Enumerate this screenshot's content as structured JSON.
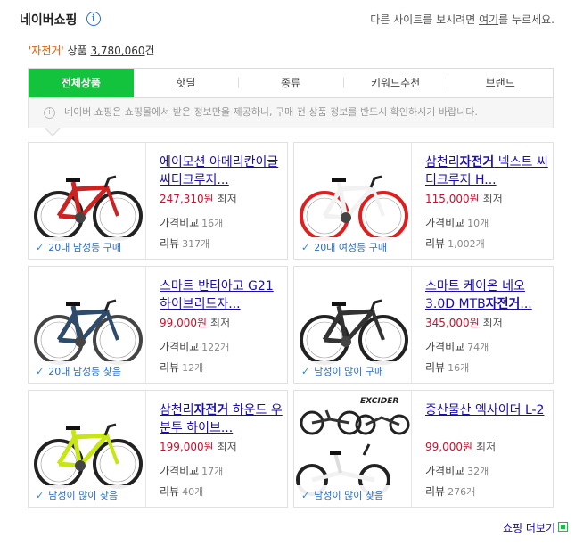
{
  "header": {
    "title": "네이버쇼핑",
    "info_icon": "i",
    "other_prefix": "다른 사이트를 보시려면 ",
    "other_link": "여기",
    "other_suffix": "를 누르세요."
  },
  "summary": {
    "keyword": "'자전거'",
    "label": " 상품 ",
    "count": "3,780,060",
    "unit": "건"
  },
  "tabs": [
    {
      "label": "전체상품"
    },
    {
      "label": "핫딜"
    },
    {
      "label": "종류"
    },
    {
      "label": "키워드추천"
    },
    {
      "label": "브랜드"
    }
  ],
  "notice": {
    "icon": "i",
    "text": "네이버 쇼핑은 쇼핑몰에서 받은 정보만을 제공하니, 구매 전 상품 정보를 반드시 확인하시기 바랍니다."
  },
  "products": [
    {
      "name_pre": "에이모션 아메리칸이글 씨티크루저...",
      "name_bold": "",
      "name_post": "",
      "price": "247,310원",
      "lowest": "최저",
      "compare_label": "가격비교",
      "compare_count": "16개",
      "review_label": "리뷰",
      "review_count": "317개",
      "badge_strong": "20대 남성",
      "badge_rest": "등 구매",
      "frame_color": "#cc2222",
      "rim_color": "#222222"
    },
    {
      "name_pre": "삼천리",
      "name_bold": "자전거",
      "name_post": " 넥스트 씨티크루저 H...",
      "price": "115,000원",
      "lowest": "최저",
      "compare_label": "가격비교",
      "compare_count": "10개",
      "review_label": "리뷰",
      "review_count": "1,002개",
      "badge_strong": "20대 여성",
      "badge_rest": "등 구매",
      "frame_color": "#f2f2f2",
      "rim_color": "#dd1f1f"
    },
    {
      "name_pre": "스마트 반티아고 G21 하이브리드자...",
      "name_bold": "",
      "name_post": "",
      "price": "99,000원",
      "lowest": "최저",
      "compare_label": "가격비교",
      "compare_count": "122개",
      "review_label": "리뷰",
      "review_count": "12개",
      "badge_strong": "20대 남성",
      "badge_rest": "등 찾음",
      "frame_color": "#2d4b6a",
      "rim_color": "#444444"
    },
    {
      "name_pre": "스마트 케이온 네오 3.0D MTB",
      "name_bold": "자전거",
      "name_post": "...",
      "price": "345,000원",
      "lowest": "최저",
      "compare_label": "가격비교",
      "compare_count": "74개",
      "review_label": "리뷰",
      "review_count": "16개",
      "badge_strong": "남성",
      "badge_rest": "이 많이 구매",
      "frame_color": "#333333",
      "rim_color": "#222222"
    },
    {
      "name_pre": "삼천리",
      "name_bold": "자전거",
      "name_post": " 하운드 우분투 하이브...",
      "price": "199,000원",
      "lowest": "최저",
      "compare_label": "가격비교",
      "compare_count": "17개",
      "review_label": "리뷰",
      "review_count": "40개",
      "badge_strong": "남성",
      "badge_rest": "이 많이 찾음",
      "frame_color": "#c8e614",
      "rim_color": "#222222"
    },
    {
      "name_pre": "중산물산 엑사이더 L-2",
      "name_bold": "",
      "name_post": "",
      "price": "99,000원",
      "lowest": "최저",
      "compare_label": "가격비교",
      "compare_count": "32개",
      "review_label": "리뷰",
      "review_count": "276개",
      "badge_strong": "남성",
      "badge_rest": "이 많이 찾음",
      "frame_color": "#222222",
      "rim_color": "#333333",
      "thumb_brand": "EXCIDER"
    }
  ],
  "footer": {
    "more_link": "쇼핑 더보기"
  },
  "colors": {
    "accent_green": "#13c33d",
    "price_red": "#c8102e",
    "link_blue": "#1a0dab"
  }
}
